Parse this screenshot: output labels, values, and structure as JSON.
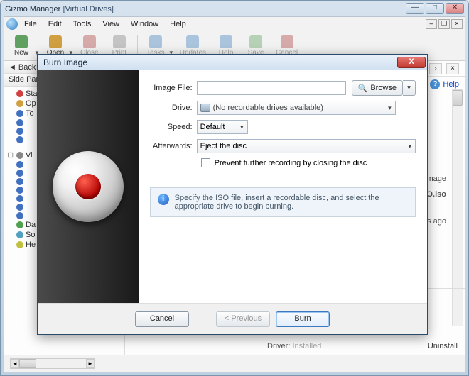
{
  "window": {
    "app_title": "Gizmo Manager",
    "doc_title": "[Virtual Drives]"
  },
  "menubar": {
    "items": [
      "File",
      "Edit",
      "Tools",
      "View",
      "Window",
      "Help"
    ]
  },
  "toolbar": {
    "items": [
      {
        "label": "New",
        "dim": false,
        "dropdown": true
      },
      {
        "label": "Open",
        "dim": false,
        "dropdown": true
      },
      {
        "label": "Close",
        "dim": true
      },
      {
        "label": "Print",
        "dim": true
      },
      {
        "label": "Tasks",
        "dim": true,
        "dropdown": true
      },
      {
        "label": "Updates",
        "dim": true
      },
      {
        "label": "Help",
        "dim": true
      },
      {
        "label": "Save",
        "dim": true
      },
      {
        "label": "Cancel",
        "dim": true
      }
    ]
  },
  "sidepanel": {
    "header": "Side Panel",
    "back_label": "Back",
    "tree": [
      {
        "label": "Sta",
        "color": "#d04040"
      },
      {
        "label": "Op",
        "color": "#d0a040"
      },
      {
        "label": "To",
        "color": "#4070c0"
      },
      {
        "label": "",
        "color": "#4070c0"
      },
      {
        "label": "",
        "color": "#4070c0"
      },
      {
        "label": "",
        "color": "#4070c0"
      },
      {
        "label": "Vi",
        "color": "#888",
        "group": true
      },
      {
        "label": "",
        "color": "#4070c0"
      },
      {
        "label": "",
        "color": "#4070c0"
      },
      {
        "label": "",
        "color": "#4070c0"
      },
      {
        "label": "",
        "color": "#4070c0"
      },
      {
        "label": "",
        "color": "#4070c0"
      },
      {
        "label": "",
        "color": "#4070c0"
      },
      {
        "label": "",
        "color": "#4070c0"
      },
      {
        "label": "Da",
        "color": "#50a050"
      },
      {
        "label": "So",
        "color": "#50a0c0"
      },
      {
        "label": "He",
        "color": "#c0c040"
      }
    ]
  },
  "right": {
    "help": "Help",
    "burn_image": "n Image",
    "iso_name": " ISO.iso",
    "ago": "ays ago",
    "driver_label": "Driver:",
    "driver_value": "Installed",
    "uninstall": "Uninstall"
  },
  "dialog": {
    "title": "Burn Image",
    "labels": {
      "image_file": "Image File:",
      "drive": "Drive:",
      "speed": "Speed:",
      "afterwards": "Afterwards:"
    },
    "image_file_value": "",
    "browse": "Browse",
    "drive_value": "(No recordable drives available)",
    "speed_value": "Default",
    "afterwards_value": "Eject the disc",
    "prevent_label": "Prevent further recording by closing the disc",
    "info": "Specify the ISO file, insert a recordable disc, and select the appropriate drive to begin burning.",
    "buttons": {
      "cancel": "Cancel",
      "previous": "< Previous",
      "burn": "Burn"
    }
  }
}
